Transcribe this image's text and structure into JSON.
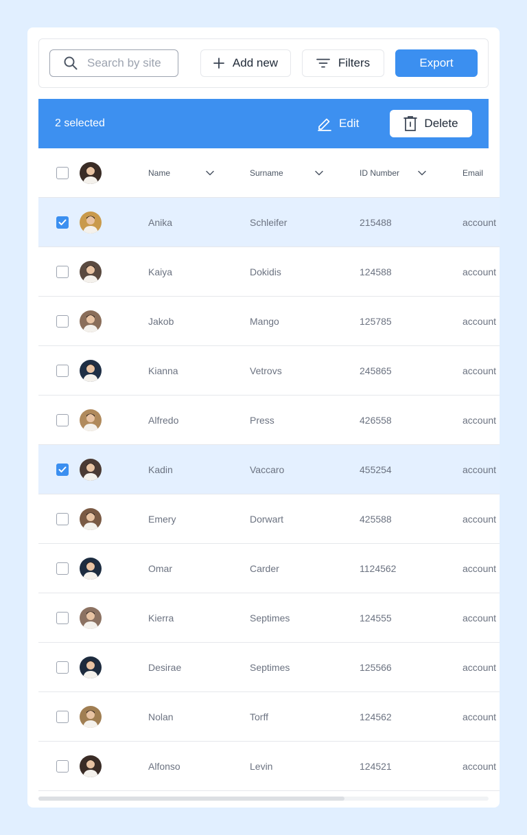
{
  "toolbar": {
    "search_placeholder": "Search by site",
    "add_label": "Add new",
    "filters_label": "Filters",
    "export_label": "Export",
    "accent": "#3b8ff0"
  },
  "selection": {
    "count_label": "2 selected",
    "edit_label": "Edit",
    "delete_label": "Delete"
  },
  "table": {
    "headers": {
      "name": "Name",
      "surname": "Surname",
      "id": "ID Number",
      "email": "Email"
    },
    "rows": [
      {
        "name": "Anika",
        "surname": "Schleifer",
        "id": "215488",
        "email": "account",
        "selected": true,
        "avatar": "#c99a4c"
      },
      {
        "name": "Kaiya",
        "surname": "Dokidis",
        "id": "124588",
        "email": "account",
        "selected": false,
        "avatar": "#5a4a40"
      },
      {
        "name": "Jakob",
        "surname": "Mango",
        "id": "125785",
        "email": "account",
        "selected": false,
        "avatar": "#8a6e5a"
      },
      {
        "name": "Kianna",
        "surname": "Vetrovs",
        "id": "245865",
        "email": "account",
        "selected": false,
        "avatar": "#1f2f45"
      },
      {
        "name": "Alfredo",
        "surname": "Press",
        "id": "426558",
        "email": "account",
        "selected": false,
        "avatar": "#b08a5c"
      },
      {
        "name": "Kadin",
        "surname": "Vaccaro",
        "id": "455254",
        "email": "account",
        "selected": true,
        "avatar": "#4a3a34"
      },
      {
        "name": "Emery",
        "surname": "Dorwart",
        "id": "425588",
        "email": "account",
        "selected": false,
        "avatar": "#7a5a44"
      },
      {
        "name": "Omar",
        "surname": "Carder",
        "id": "1124562",
        "email": "account",
        "selected": false,
        "avatar": "#1c2c40"
      },
      {
        "name": "Kierra",
        "surname": "Septimes",
        "id": "124555",
        "email": "account",
        "selected": false,
        "avatar": "#8c7262"
      },
      {
        "name": "Desirae",
        "surname": "Septimes",
        "id": "125566",
        "email": "account",
        "selected": false,
        "avatar": "#1d2b3e"
      },
      {
        "name": "Nolan",
        "surname": "Torff",
        "id": "124562",
        "email": "account",
        "selected": false,
        "avatar": "#a07e52"
      },
      {
        "name": "Alfonso",
        "surname": "Levin",
        "id": "124521",
        "email": "account",
        "selected": false,
        "avatar": "#3a2c26"
      }
    ],
    "header_avatar": "#3a2c26"
  }
}
